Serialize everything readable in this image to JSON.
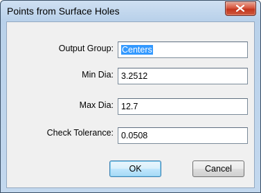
{
  "window": {
    "title": "Points from Surface Holes"
  },
  "form": {
    "fields": [
      {
        "label": "Output Group:",
        "value": "Centers"
      },
      {
        "label": "Min Dia:",
        "value": "3.2512"
      },
      {
        "label": "Max Dia:",
        "value": "12.7"
      },
      {
        "label": "Check Tolerance:",
        "value": "0.0508"
      }
    ]
  },
  "buttons": {
    "ok_label": "OK",
    "cancel_label": "Cancel"
  },
  "icons": {
    "close": "close-icon"
  },
  "colors": {
    "selection": "#3399ff",
    "close_button": "#c2361e",
    "titlebar": "#b9d1ea"
  }
}
